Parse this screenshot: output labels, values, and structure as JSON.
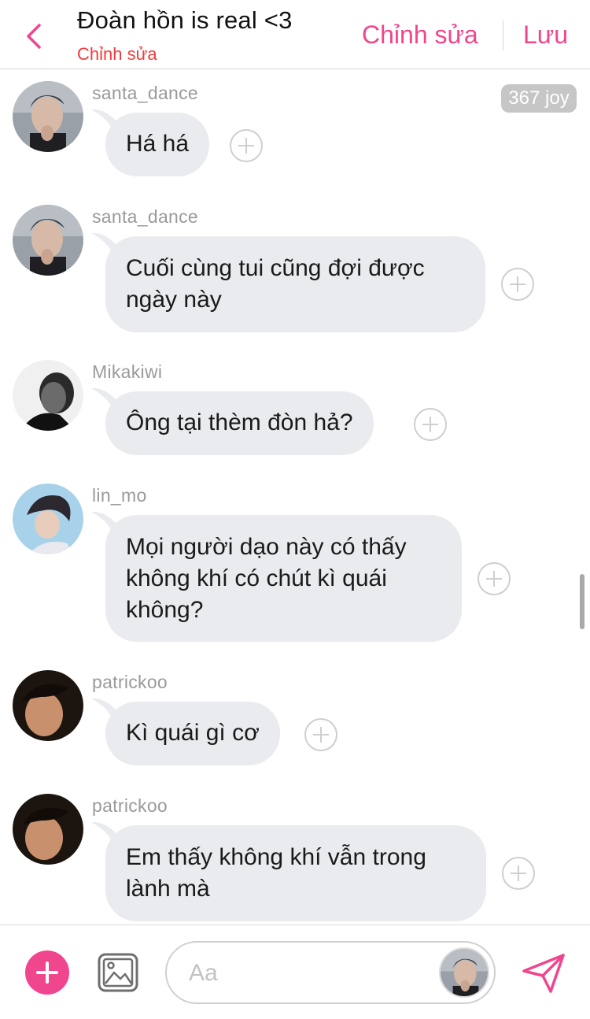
{
  "header": {
    "title": "Đoàn hồn is real <3",
    "subtitle": "Chỉnh sửa",
    "edit_label": "Chỉnh sửa",
    "save_label": "Lưu"
  },
  "badge": {
    "joy": "367 joy"
  },
  "messages": [
    {
      "user": "santa_dance",
      "lines": [
        "Há há"
      ]
    },
    {
      "user": "santa_dance",
      "lines": [
        "Cuối cùng tui cũng đợi được",
        "ngày này"
      ]
    },
    {
      "user": "Mikakiwi",
      "lines": [
        "Ông tại thèm đòn hả?"
      ]
    },
    {
      "user": "lin_mo",
      "lines": [
        "Mọi người dạo này có thấy",
        "không khí có chút kì quái",
        "không?"
      ]
    },
    {
      "user": "patrickoo",
      "lines": [
        "Kì quái gì cơ"
      ]
    },
    {
      "user": "patrickoo",
      "lines": [
        "Em thấy không khí vẫn trong",
        "lành mà"
      ]
    }
  ],
  "composer": {
    "placeholder": "Aa"
  },
  "icons": {
    "back": "chevron-left-icon",
    "add": "plus-icon",
    "image": "image-icon",
    "send": "send-icon",
    "react": "plus-circle-icon"
  },
  "colors": {
    "accent": "#f0468e",
    "subtitle": "#f23b3b",
    "bubble": "#e9ebee"
  }
}
